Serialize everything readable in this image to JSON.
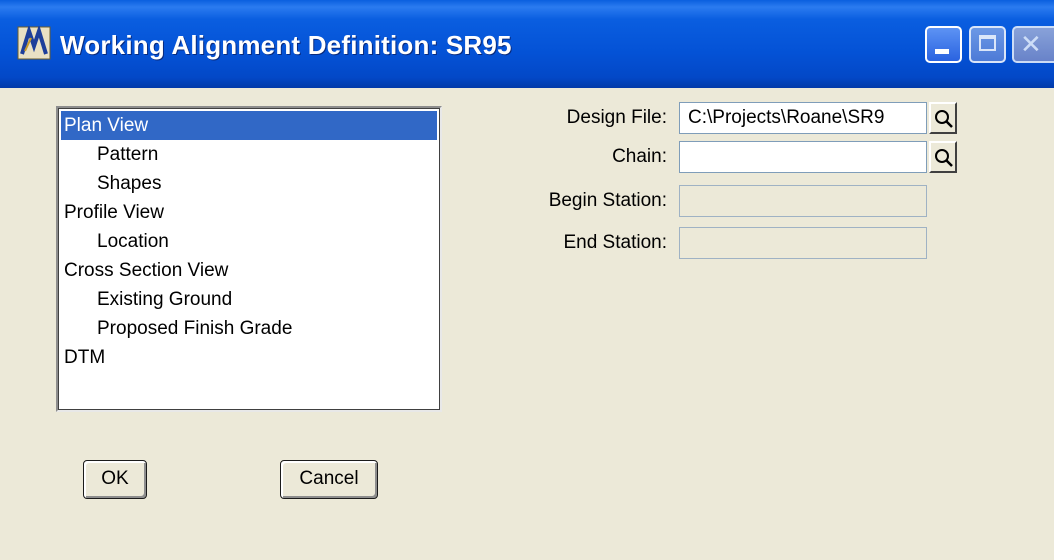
{
  "window": {
    "title": "Working Alignment Definition: SR95",
    "controls": [
      "minimize",
      "maximize",
      "close"
    ]
  },
  "tree": {
    "items": [
      {
        "label": "Plan View",
        "level": 0,
        "selected": true
      },
      {
        "label": "Pattern",
        "level": 1,
        "selected": false
      },
      {
        "label": "Shapes",
        "level": 1,
        "selected": false
      },
      {
        "label": "Profile View",
        "level": 0,
        "selected": false
      },
      {
        "label": "Location",
        "level": 1,
        "selected": false
      },
      {
        "label": "Cross Section View",
        "level": 0,
        "selected": false
      },
      {
        "label": "Existing Ground",
        "level": 1,
        "selected": false
      },
      {
        "label": "Proposed Finish Grade",
        "level": 1,
        "selected": false
      },
      {
        "label": "DTM",
        "level": 0,
        "selected": false
      }
    ]
  },
  "fields": {
    "design_file": {
      "label": "Design File:",
      "value": "C:\\Projects\\Roane\\SR9"
    },
    "chain": {
      "label": "Chain:",
      "value": ""
    },
    "begin_station": {
      "label": "Begin Station:",
      "value": ""
    },
    "end_station": {
      "label": "End Station:",
      "value": ""
    }
  },
  "buttons": {
    "ok": "OK",
    "cancel": "Cancel"
  },
  "colors": {
    "titlebar": "#0452d6",
    "dialog_bg": "#ece9d8",
    "selection": "#3168c6"
  },
  "icons": {
    "app": "app-icon",
    "design_file_lookup": "magnifier-icon",
    "chain_lookup": "magnifier-icon"
  }
}
